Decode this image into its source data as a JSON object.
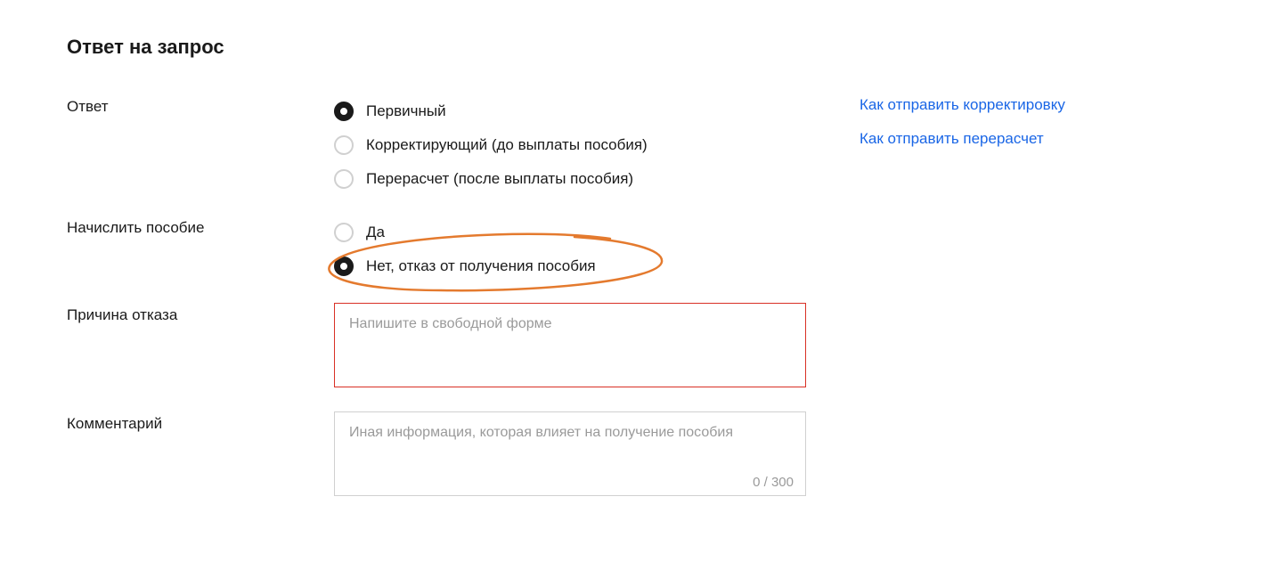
{
  "title": "Ответ на запрос",
  "fields": {
    "answer": {
      "label": "Ответ",
      "options": [
        {
          "label": "Первичный",
          "selected": true
        },
        {
          "label": "Корректирующий (до выплаты пособия)",
          "selected": false
        },
        {
          "label": "Перерасчет (после выплаты пособия)",
          "selected": false
        }
      ]
    },
    "accrue": {
      "label": "Начислить пособие",
      "options": [
        {
          "label": "Да",
          "selected": false
        },
        {
          "label": "Нет, отказ от получения пособия",
          "selected": true
        }
      ]
    },
    "reason": {
      "label": "Причина отказа",
      "placeholder": "Напишите в свободной форме"
    },
    "comment": {
      "label": "Комментарий",
      "placeholder": "Иная информация, которая влияет на получение пособия",
      "counter": "0 / 300"
    }
  },
  "links": {
    "correction": "Как отправить корректировку",
    "recalc": "Как отправить перерасчет"
  }
}
